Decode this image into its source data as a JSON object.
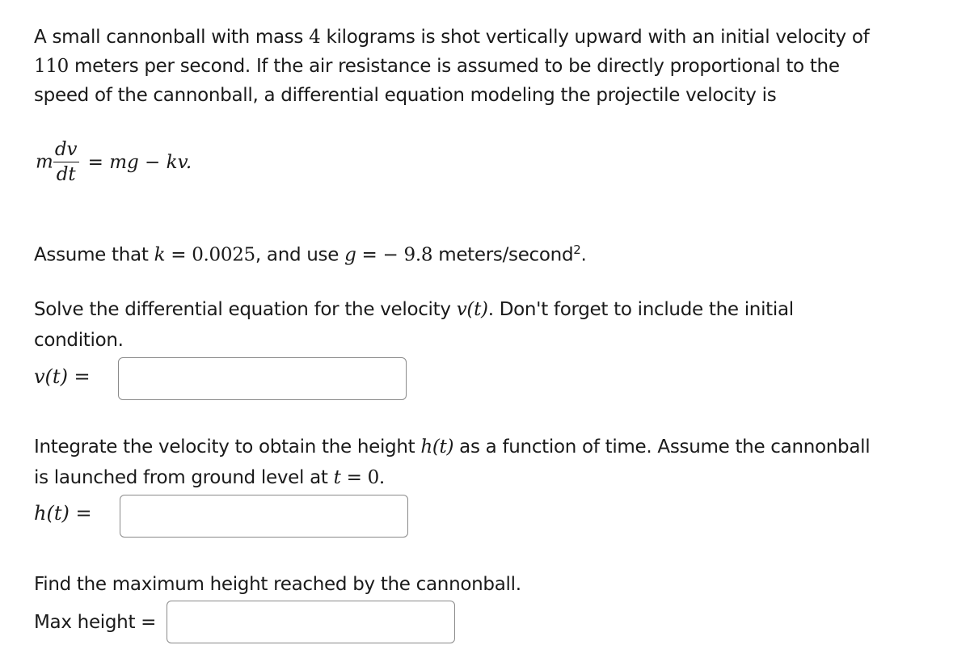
{
  "intro": {
    "line1_a": "A small cannonball with mass ",
    "mass": "4",
    "line1_b": " kilograms is shot vertically upward with an initial velocity of",
    "velocity": "110",
    "line2_b": " meters per second. If the air resistance is assumed to be directly proportional to the",
    "line3": "speed of the cannonball, a differential equation modeling the projectile velocity is"
  },
  "equation": {
    "lhs_m": "m",
    "numerator": "dv",
    "denominator": "dt",
    "rhs": "= mg − kv."
  },
  "assumption": {
    "text_a": "Assume that ",
    "k_var": "k",
    "k_eq": " = 0.0025",
    "text_b": ", and use ",
    "g_var": "g",
    "g_eq": " =  − 9.8",
    "units": " meters/second",
    "units_exp": "2",
    "period": "."
  },
  "question1": {
    "text_a": "Solve the differential equation for the velocity ",
    "expr": "v(t)",
    "text_b": ". Don't forget to include the initial",
    "text_c": "condition.",
    "label": "v(t) =",
    "value": ""
  },
  "question2": {
    "text_a": "Integrate the velocity to obtain the height ",
    "expr": "h(t)",
    "text_b": " as a function of time. Assume the cannonball",
    "text_c": "is launched from ground level at ",
    "t_var": "t",
    "t_eq": " = 0.",
    "label": "h(t) =",
    "value": ""
  },
  "question3": {
    "text": "Find the maximum height reached by the cannonball.",
    "label": "Max height =",
    "value": ""
  }
}
